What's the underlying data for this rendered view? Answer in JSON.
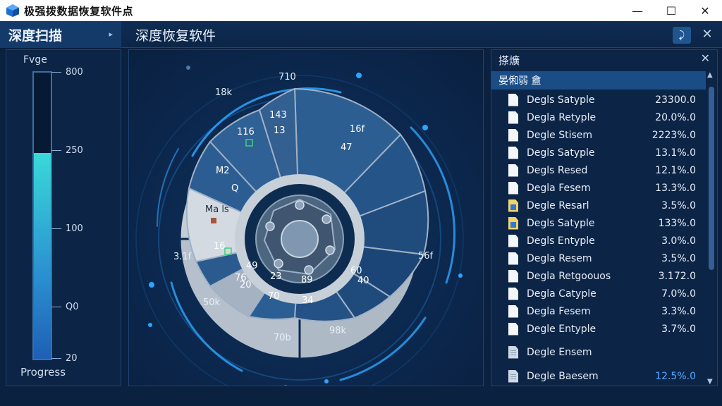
{
  "window": {
    "title": "极强拨数据恢复软件点",
    "minimize_icon": "minimize-icon",
    "maximize_icon": "maximize-icon",
    "close_icon": "close-icon"
  },
  "sidebar": {
    "title": "深度扫描",
    "progress_label": "Fvge",
    "progress_footer": "Progress",
    "ticks": [
      "800",
      "250",
      "100",
      "Q0",
      "20"
    ],
    "fill_fraction": 0.72,
    "fill_colors": [
      "#3ad9d9",
      "#1f5fb5"
    ]
  },
  "main": {
    "title": "深度恢复软件"
  },
  "disk": {
    "inner_labels": [
      "143",
      "13",
      "116",
      "M2",
      "Q",
      "16",
      "49",
      "76",
      "20",
      "23",
      "70",
      "89",
      "34",
      "60",
      "40",
      "16f",
      "47",
      "Ma ls"
    ],
    "outer_labels": [
      "710",
      "18k",
      "3.1f",
      "50k",
      "70b",
      "98k",
      "56f"
    ],
    "accent_color": "#2aa6ff"
  },
  "right_panel": {
    "title": "搽爌",
    "subheader": "晏俰弱 盦",
    "rows": [
      {
        "icon": "file-icon",
        "name": "Degls Satyple",
        "value": "23300.0"
      },
      {
        "icon": "file-icon",
        "name": "Degla Retyple",
        "value": "20.0%.0"
      },
      {
        "icon": "file-icon",
        "name": "Degle Stisem",
        "value": "2223%.0"
      },
      {
        "icon": "file-icon",
        "name": "Degls Satyple",
        "value": "13.1%.0"
      },
      {
        "icon": "file-icon",
        "name": "Degls Resed",
        "value": "12.1%.0"
      },
      {
        "icon": "file-icon",
        "name": "Degla Fesem",
        "value": "13.3%.0"
      },
      {
        "icon": "image-file-icon",
        "name": "Degle Resarl",
        "value": "3.5%.0"
      },
      {
        "icon": "image-file-icon",
        "name": "Degls Satyple",
        "value": "133%.0"
      },
      {
        "icon": "file-icon",
        "name": "Degls Entyple",
        "value": "3.0%.0"
      },
      {
        "icon": "file-icon",
        "name": "Degla Resem",
        "value": "3.5%.0"
      },
      {
        "icon": "file-icon",
        "name": "Degla Retgoouos",
        "value": "3.172.0"
      },
      {
        "icon": "file-icon",
        "name": "Degla Catyple",
        "value": "7.0%.0"
      },
      {
        "icon": "file-icon",
        "name": "Degla Fesem",
        "value": "3.3%.0"
      },
      {
        "icon": "file-icon",
        "name": "Degle Entyple",
        "value": "3.7%.0"
      },
      {
        "icon": "document-icon",
        "name": "Degle Ensem",
        "value": ""
      },
      {
        "icon": "document-icon",
        "name": "Degle Baesem",
        "value": "12.5%.0",
        "highlight": true
      }
    ]
  }
}
